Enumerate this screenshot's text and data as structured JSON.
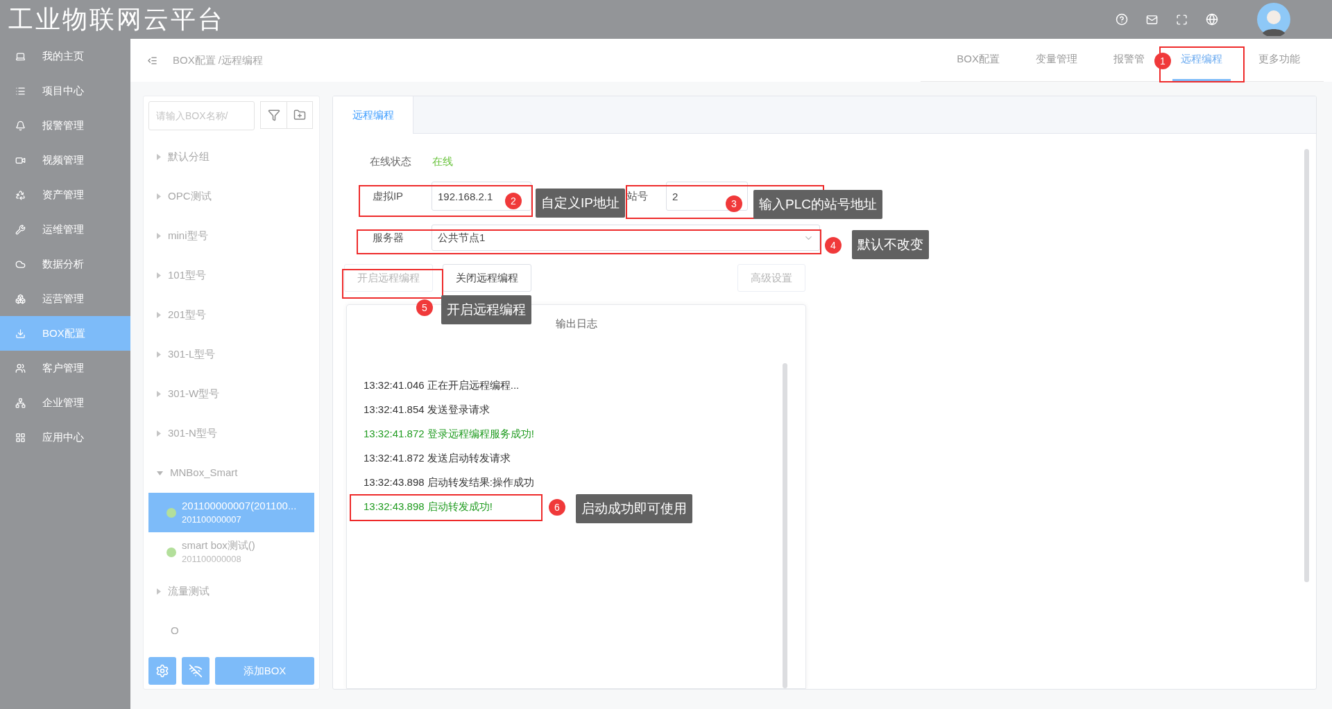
{
  "app": {
    "title": "工业物联网云平台"
  },
  "sidebar": {
    "items": [
      {
        "label": "我的主页",
        "selected": false
      },
      {
        "label": "项目中心",
        "selected": false
      },
      {
        "label": "报警管理",
        "selected": false
      },
      {
        "label": "视频管理",
        "selected": false
      },
      {
        "label": "资产管理",
        "selected": false
      },
      {
        "label": "运维管理",
        "selected": false
      },
      {
        "label": "数据分析",
        "selected": false
      },
      {
        "label": "运营管理",
        "selected": false
      },
      {
        "label": "BOX配置",
        "selected": true
      },
      {
        "label": "客户管理",
        "selected": false
      },
      {
        "label": "企业管理",
        "selected": false
      },
      {
        "label": "应用中心",
        "selected": false
      }
    ]
  },
  "header": {
    "breadcrumb": "BOX配置 /远程编程",
    "tabs": [
      {
        "label": "BOX配置",
        "selected": false
      },
      {
        "label": "变量管理",
        "selected": false
      },
      {
        "label": "报警管",
        "selected": false
      },
      {
        "label": "远程编程",
        "selected": true
      },
      {
        "label": "更多功能",
        "selected": false
      }
    ]
  },
  "box_panel": {
    "search": {
      "placeholder": "请输入BOX名称/"
    },
    "groups": [
      {
        "label": "默认分组",
        "expandable": true,
        "expanded": false
      },
      {
        "label": "OPC测试",
        "expandable": true,
        "expanded": false
      },
      {
        "label": "mini型号",
        "expandable": true,
        "expanded": false
      },
      {
        "label": "101型号",
        "expandable": true,
        "expanded": false
      },
      {
        "label": "201型号",
        "expandable": true,
        "expanded": false
      },
      {
        "label": "301-L型号",
        "expandable": true,
        "expanded": false
      },
      {
        "label": "301-W型号",
        "expandable": true,
        "expanded": false
      },
      {
        "label": "301-N型号",
        "expandable": true,
        "expanded": false
      },
      {
        "label": "MNBox_Smart",
        "expandable": true,
        "expanded": true,
        "children": [
          {
            "name": "201100000007(201100...",
            "serial": "201100000007",
            "online": true,
            "selected": true
          },
          {
            "name": "smart box测试()",
            "serial": "201100000008",
            "online": true,
            "selected": false
          }
        ]
      },
      {
        "label": "流量测试",
        "expandable": true,
        "expanded": false
      },
      {
        "label": "O",
        "expandable": false
      }
    ],
    "add_button": "添加BOX"
  },
  "remote": {
    "tabs": [
      {
        "label": "远程编程",
        "selected": true
      }
    ],
    "status": {
      "label": "在线状态",
      "value": "在线",
      "online": true
    },
    "ip": {
      "label": "虚拟IP",
      "value": "192.168.2.1"
    },
    "station": {
      "label": "站号",
      "value": "2"
    },
    "server": {
      "label": "服务器",
      "value": "公共节点1"
    },
    "buttons": [
      {
        "label": "开启远程编程",
        "disabled": true
      },
      {
        "label": "关闭远程编程",
        "disabled": false
      },
      {
        "label": "高级设置",
        "disabled": true
      }
    ],
    "log": {
      "title": "输出日志",
      "lines": [
        {
          "text": "13:32:41.046 正在开启远程编程...",
          "success": false
        },
        {
          "text": "13:32:41.854 发送登录请求",
          "success": false
        },
        {
          "text": "13:32:41.872 登录远程编程服务成功!",
          "success": true
        },
        {
          "text": "13:32:41.872 发送启动转发请求",
          "success": false
        },
        {
          "text": "13:32:43.898 启动转发结果:操作成功",
          "success": false
        },
        {
          "text": "13:32:43.898 启动转发成功!",
          "success": true
        }
      ]
    }
  },
  "annotations": [
    {
      "number": "1"
    },
    {
      "number": "2",
      "note": "自定义IP地址"
    },
    {
      "number": "3",
      "note": "输入PLC的站号地址"
    },
    {
      "number": "4",
      "note": "默认不改变"
    },
    {
      "number": "5",
      "note": "开启远程编程"
    },
    {
      "number": "6",
      "note": "启动成功即可使用"
    }
  ]
}
